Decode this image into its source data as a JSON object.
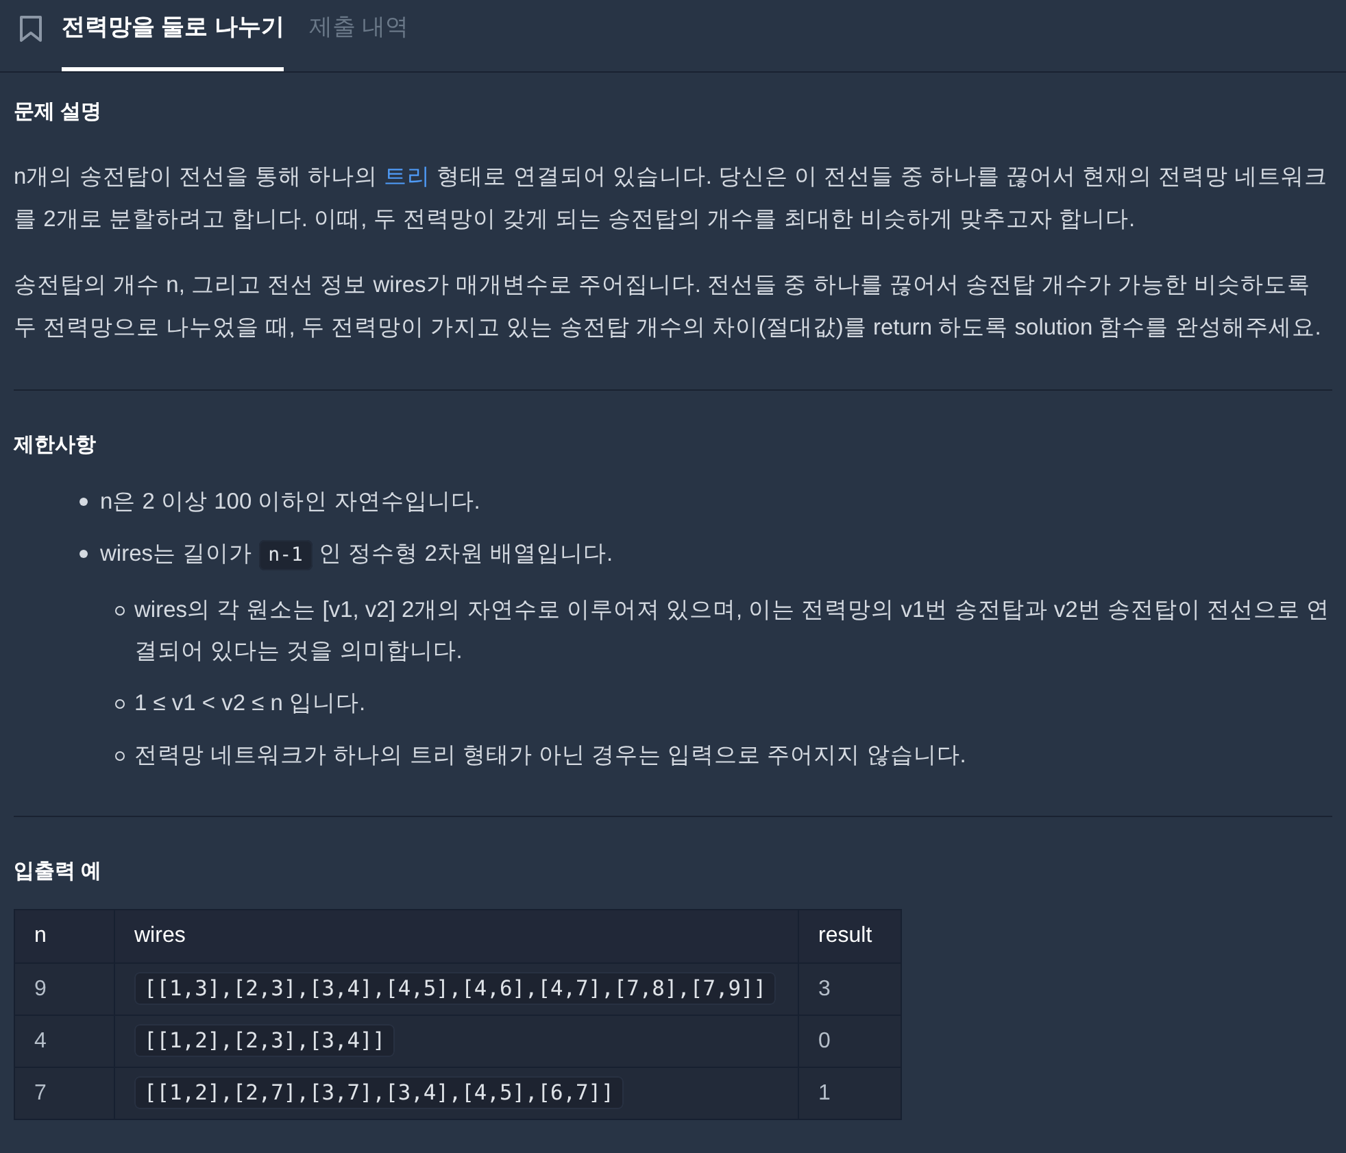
{
  "tabs": [
    {
      "label": "전력망을 둘로 나누기",
      "selected": true
    },
    {
      "label": "제출 내역",
      "selected": false
    }
  ],
  "description": {
    "title": "문제 설명",
    "paragraphs": [
      [
        {
          "kind": "text",
          "text": "n개의 송전탑이 전선을 통해 하나의 "
        },
        {
          "kind": "link",
          "text": "트리"
        },
        {
          "kind": "text",
          "text": " 형태로 연결되어 있습니다. 당신은 이 전선들 중 하나를 끊어서 현재의 전력망 네트워크를 2개로 분할하려고 합니다. 이때, 두 전력망이 갖게 되는 송전탑의 개수를 최대한 비슷하게 맞추고자 합니다."
        }
      ],
      [
        {
          "kind": "text",
          "text": "송전탑의 개수 n, 그리고 전선 정보 wires가 매개변수로 주어집니다. 전선들 중 하나를 끊어서 송전탑 개수가 가능한 비슷하도록 두 전력망으로 나누었을 때, 두 전력망이 가지고 있는 송전탑 개수의 차이(절대값)를 return 하도록 solution 함수를 완성해주세요."
        }
      ]
    ]
  },
  "constraints": {
    "title": "제한사항",
    "items": [
      {
        "segments": [
          {
            "kind": "text",
            "text": "n은 2 이상 100 이하인 자연수입니다."
          }
        ]
      },
      {
        "segments": [
          {
            "kind": "text",
            "text": "wires는 길이가 "
          },
          {
            "kind": "code",
            "text": "n-1"
          },
          {
            "kind": "text",
            "text": " 인 정수형 2차원 배열입니다."
          }
        ],
        "children": [
          {
            "segments": [
              {
                "kind": "text",
                "text": "wires의 각 원소는 [v1, v2] 2개의 자연수로 이루어져 있으며, 이는 전력망의 v1번 송전탑과 v2번 송전탑이 전선으로 연결되어 있다는 것을 의미합니다."
              }
            ]
          },
          {
            "segments": [
              {
                "kind": "text",
                "text": "1 ≤ v1 < v2 ≤ n 입니다."
              }
            ]
          },
          {
            "segments": [
              {
                "kind": "text",
                "text": "전력망 네트워크가 하나의 트리 형태가 아닌 경우는 입력으로 주어지지 않습니다."
              }
            ]
          }
        ]
      }
    ]
  },
  "examples": {
    "title": "입출력 예",
    "columns": [
      {
        "label": "n",
        "kind": "text"
      },
      {
        "label": "wires",
        "kind": "code"
      },
      {
        "label": "result",
        "kind": "text"
      }
    ],
    "rows": [
      [
        "9",
        "[[1,3],[2,3],[3,4],[4,5],[4,6],[4,7],[7,8],[7,9]]",
        "3"
      ],
      [
        "4",
        "[[1,2],[2,3],[3,4]]",
        "0"
      ],
      [
        "7",
        "[[1,2],[2,7],[3,7],[3,4],[4,5],[6,7]]",
        "1"
      ]
    ]
  }
}
